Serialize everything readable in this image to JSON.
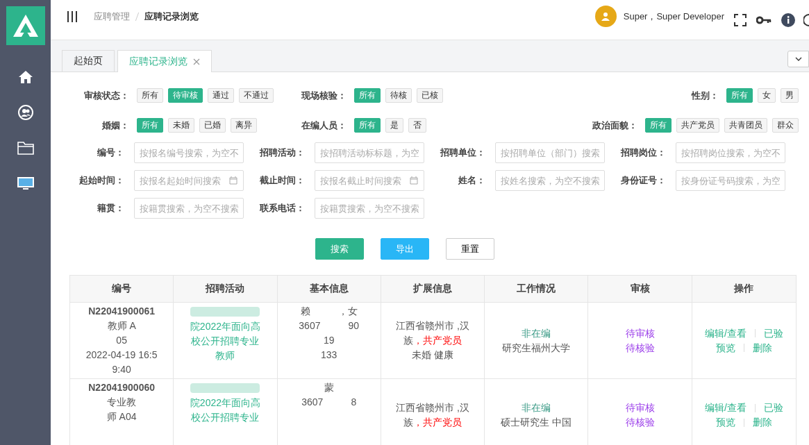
{
  "sidebar": {
    "items": [
      {
        "selected": false
      },
      {
        "selected": false
      },
      {
        "selected": false
      },
      {
        "selected": false
      }
    ]
  },
  "header": {
    "breadcrumb": [
      "应聘管理",
      "应聘记录浏览"
    ],
    "user": "Super，Super Developer"
  },
  "tabs": [
    {
      "label": "起始页",
      "selected": false,
      "closable": false
    },
    {
      "label": "应聘记录浏览",
      "selected": true,
      "closable": true
    }
  ],
  "filters": [
    {
      "label": "审核状态：",
      "options": [
        {
          "label": "所有",
          "selected": false
        },
        {
          "label": "待审核",
          "selected": true
        },
        {
          "label": "通过",
          "selected": false
        },
        {
          "label": "不通过",
          "selected": false
        }
      ]
    },
    {
      "label": "现场核验：",
      "options": [
        {
          "label": "所有",
          "selected": true
        },
        {
          "label": "待核",
          "selected": false
        },
        {
          "label": "已核",
          "selected": false
        }
      ]
    },
    {
      "label": "性别：",
      "options": [
        {
          "label": "所有",
          "selected": true
        },
        {
          "label": "女",
          "selected": false
        },
        {
          "label": "男",
          "selected": false
        }
      ]
    },
    {
      "label": "婚姻：",
      "options": [
        {
          "label": "所有",
          "selected": true
        },
        {
          "label": "未婚",
          "selected": false
        },
        {
          "label": "已婚",
          "selected": false
        },
        {
          "label": "离异",
          "selected": false
        }
      ]
    },
    {
      "label": "在编人员：",
      "options": [
        {
          "label": "所有",
          "selected": true
        },
        {
          "label": "是",
          "selected": false
        },
        {
          "label": "否",
          "selected": false
        }
      ]
    },
    {
      "label": "政治面貌：",
      "options": [
        {
          "label": "所有",
          "selected": true
        },
        {
          "label": "共产党员",
          "selected": false
        },
        {
          "label": "共青团员",
          "selected": false
        },
        {
          "label": "群众",
          "selected": false
        }
      ]
    }
  ],
  "fields": [
    {
      "label": "编号：",
      "placeholder": "按报名编号搜索，为空不",
      "kind": "text"
    },
    {
      "label": "招聘活动：",
      "placeholder": "按招聘活动标标题，为空",
      "kind": "text"
    },
    {
      "label": "招聘单位：",
      "placeholder": "按招聘单位（部门）搜索",
      "kind": "text"
    },
    {
      "label": "招聘岗位：",
      "placeholder": "按招聘岗位搜索，为空不",
      "kind": "text"
    },
    {
      "label": "起始时间：",
      "placeholder": "按报名起始时间搜索",
      "kind": "date"
    },
    {
      "label": "截止时间：",
      "placeholder": "按报名截止时间搜索",
      "kind": "date"
    },
    {
      "label": "姓名：",
      "placeholder": "按姓名搜索，为空不搜索",
      "kind": "text"
    },
    {
      "label": "身份证号：",
      "placeholder": "按身份证号码搜索，为空",
      "kind": "text"
    },
    {
      "label": "籍贯：",
      "placeholder": "按籍贯搜索，为空不搜索",
      "kind": "text"
    },
    {
      "label": "联系电话：",
      "placeholder": "按籍贯搜索，为空不搜索",
      "kind": "text"
    }
  ],
  "buttons": [
    {
      "label": "搜索",
      "kind": "primary"
    },
    {
      "label": "导出",
      "kind": "info"
    },
    {
      "label": "重置",
      "kind": "default"
    }
  ],
  "table": {
    "columns": [
      "编号",
      "招聘活动",
      "基本信息",
      "扩展信息",
      "工作情况",
      "审核",
      "操作"
    ],
    "rows": [
      {
        "number": "N22041900061",
        "number_lines": [
          "教师 A",
          "05",
          "2022-04-19 16:5",
          "9:40"
        ],
        "activity": [
          "院2022年面向高",
          "校公开招聘专业",
          "教师"
        ],
        "basic": [
          [
            "赖",
            "，女"
          ],
          [
            "3607",
            "90"
          ],
          [
            "19"
          ],
          [
            "133"
          ]
        ],
        "ext": [
          "江西省赣州市 ,汉",
          "族",
          "，共产党员",
          "未婚 健康"
        ],
        "work_status": "非在编",
        "work": "研究生福州大学",
        "review": [
          "待审核",
          "待核验"
        ],
        "actions": [
          "编辑/查看",
          "已验",
          "预览",
          "删除"
        ]
      },
      {
        "number": "N22041900060",
        "number_lines": [
          "专业教",
          "师 A04"
        ],
        "activity": [
          "院2022年面向高",
          "校公开招聘专业"
        ],
        "basic": [
          [
            "蒙"
          ],
          [
            "3607",
            "8"
          ]
        ],
        "ext": [
          "江西省赣州市 ,汉",
          "族",
          "，共产党员"
        ],
        "work_status": "非在编",
        "work": "硕士研究生 中国",
        "review": [
          "待审核",
          "待核验"
        ],
        "actions": [
          "编辑/查看",
          "已验",
          "预览",
          "删除"
        ]
      }
    ]
  }
}
